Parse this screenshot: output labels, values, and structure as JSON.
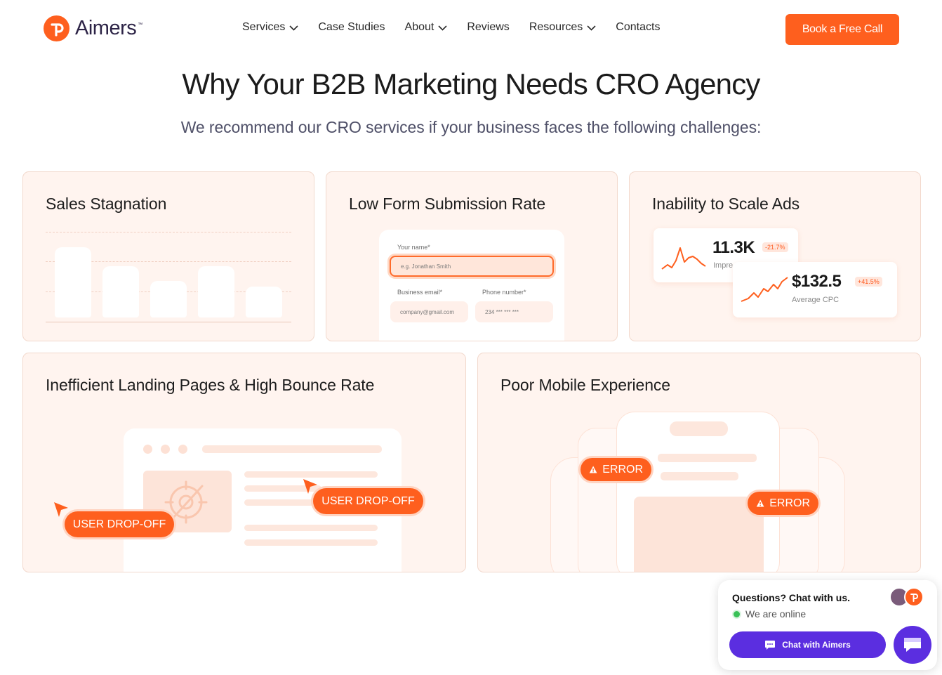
{
  "header": {
    "logo_text": "Aimers",
    "logo_tm": "™",
    "nav": [
      {
        "label": "Services",
        "has_dropdown": true
      },
      {
        "label": "Case Studies",
        "has_dropdown": false
      },
      {
        "label": "About",
        "has_dropdown": true
      },
      {
        "label": "Reviews",
        "has_dropdown": false
      },
      {
        "label": "Resources",
        "has_dropdown": true
      },
      {
        "label": "Contacts",
        "has_dropdown": false
      }
    ],
    "cta_label": "Book a Free Call"
  },
  "hero": {
    "title": "Why Your B2B Marketing Needs CRO Agency",
    "subtitle": "We recommend our CRO services if your business faces the following challenges:"
  },
  "cards": [
    {
      "title": "Sales Stagnation"
    },
    {
      "title": "Low Form Submission Rate",
      "form": {
        "name_label": "Your name*",
        "name_placeholder": "e.g. Jonathan Smith",
        "email_label": "Business email*",
        "email_placeholder": "company@gmail.com",
        "phone_label": "Phone number*",
        "phone_placeholder": "234 *** *** ***"
      }
    },
    {
      "title": "Inability to Scale Ads",
      "stats": [
        {
          "value": "11.3K",
          "delta": "-21.7%",
          "label": "Impre"
        },
        {
          "value": "$132.5",
          "delta": "+41.5%",
          "label": "Average CPC"
        }
      ]
    },
    {
      "title": "Inefficient Landing Pages & High Bounce Rate",
      "pills": [
        "USER DROP-OFF",
        "USER DROP-OFF"
      ]
    },
    {
      "title": "Poor Mobile Experience",
      "pills": [
        "ERROR",
        "ERROR"
      ]
    }
  ],
  "chat": {
    "question": "Questions? Chat with us.",
    "status": "We are online",
    "button_label": "Chat with Aimers"
  },
  "colors": {
    "accent": "#fe5f1e",
    "card_bg": "#fff4ef",
    "chat_purple": "#5b2ee0",
    "online_green": "#39c157"
  },
  "icons": [
    "logo-icon",
    "chevron-down-icon",
    "alert-triangle-icon",
    "cursor-arrow-icon",
    "crosshair-icon",
    "trend-line-icon",
    "chat-bubble-icon"
  ]
}
